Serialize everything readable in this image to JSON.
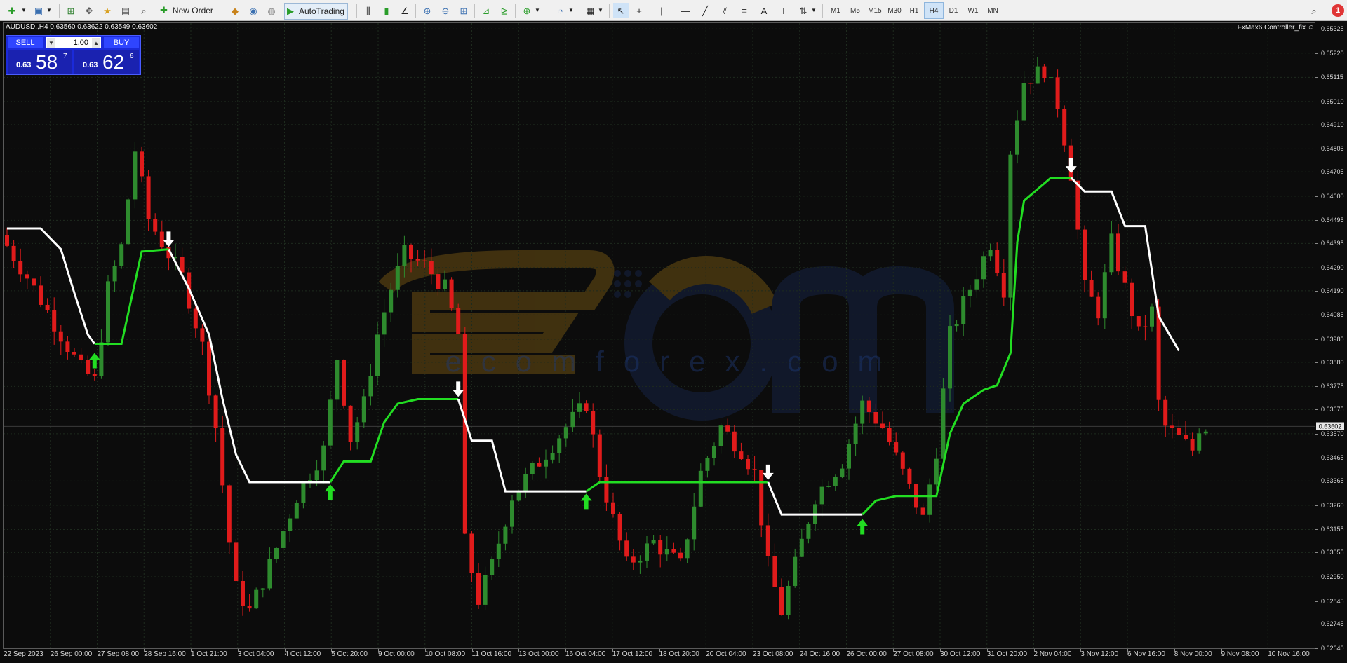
{
  "toolbar": {
    "new_order_label": "New Order",
    "autotrading_label": "AutoTrading",
    "timeframes": [
      "M1",
      "M5",
      "M15",
      "M30",
      "H1",
      "H4",
      "D1",
      "W1",
      "MN"
    ],
    "active_timeframe": "H4",
    "alert_badge": "1"
  },
  "chart": {
    "info": "AUDUSD.,H4  0.63560 0.63622 0.63549 0.63602",
    "indicator_label": "FxMax6 Controller_fix",
    "symbol": "AUDUSD.",
    "timeframe": "H4",
    "open": 0.6356,
    "high": 0.63622,
    "low": 0.63549,
    "close": 0.63602,
    "current_price_label": "0.63602",
    "current_price": 0.63602,
    "colors": {
      "bull": "#2e8b2e",
      "bear": "#e01b1b",
      "trend_up": "#22dd22",
      "trend_down": "#ffffff",
      "background": "#0c0c0c",
      "grid": "#1e2b1e"
    },
    "watermark_text": "ecomforex.com",
    "watermark_logo_letters": "ECOM"
  },
  "trade_panel": {
    "sell_label": "SELL",
    "buy_label": "BUY",
    "lot": "1.00",
    "bid": {
      "prefix": "0.63",
      "big": "58",
      "sup": "7"
    },
    "ask": {
      "prefix": "0.63",
      "big": "62",
      "sup": "6"
    }
  },
  "price_axis": {
    "labels": [
      "0.65325",
      "0.65220",
      "0.65115",
      "0.65010",
      "0.64910",
      "0.64805",
      "0.64705",
      "0.64600",
      "0.64495",
      "0.64395",
      "0.64290",
      "0.64190",
      "0.64085",
      "0.63980",
      "0.63880",
      "0.63775",
      "0.63675",
      "0.63570",
      "0.63465",
      "0.63365",
      "0.63260",
      "0.63155",
      "0.63055",
      "0.62950",
      "0.62845",
      "0.62745",
      "0.62640"
    ]
  },
  "time_axis": {
    "labels": [
      "22 Sep 2023",
      "26 Sep 00:00",
      "27 Sep 08:00",
      "28 Sep 16:00",
      "1 Oct 21:00",
      "3 Oct 04:00",
      "4 Oct 12:00",
      "5 Oct 20:00",
      "9 Oct 00:00",
      "10 Oct 08:00",
      "11 Oct 16:00",
      "13 Oct 00:00",
      "16 Oct 04:00",
      "17 Oct 12:00",
      "18 Oct 20:00",
      "20 Oct 04:00",
      "23 Oct 08:00",
      "24 Oct 16:00",
      "26 Oct 00:00",
      "27 Oct 08:00",
      "30 Oct 12:00",
      "31 Oct 20:00",
      "2 Nov 04:00",
      "3 Nov 12:00",
      "6 Nov 16:00",
      "8 Nov 00:00",
      "9 Nov 08:00",
      "10 Nov 16:00"
    ]
  },
  "chart_data": {
    "type": "candlestick",
    "symbol": "AUDUSD.",
    "timeframe": "H4",
    "ylim": [
      0.6264,
      0.6535
    ],
    "x_range": [
      "22 Sep 2023",
      "10 Nov 16:00"
    ],
    "grid": true,
    "trend_line": [
      {
        "x": 0,
        "y": 0.6446
      },
      {
        "x": 5,
        "y": 0.6446
      },
      {
        "x": 8,
        "y": 0.6437
      },
      {
        "x": 10,
        "y": 0.6418
      },
      {
        "x": 12,
        "y": 0.64
      },
      {
        "x": 13,
        "y": 0.6396
      },
      {
        "x": 17,
        "y": 0.6396
      },
      {
        "x": 20,
        "y": 0.6436
      },
      {
        "x": 24,
        "y": 0.6437
      },
      {
        "x": 27,
        "y": 0.642
      },
      {
        "x": 30,
        "y": 0.64
      },
      {
        "x": 32,
        "y": 0.6372
      },
      {
        "x": 34,
        "y": 0.6348
      },
      {
        "x": 36,
        "y": 0.6336
      },
      {
        "x": 48,
        "y": 0.6336
      },
      {
        "x": 50,
        "y": 0.6345
      },
      {
        "x": 54,
        "y": 0.6345
      },
      {
        "x": 56,
        "y": 0.6362
      },
      {
        "x": 58,
        "y": 0.637
      },
      {
        "x": 61,
        "y": 0.6372
      },
      {
        "x": 67,
        "y": 0.6372
      },
      {
        "x": 69,
        "y": 0.6354
      },
      {
        "x": 72,
        "y": 0.6354
      },
      {
        "x": 74,
        "y": 0.6332
      },
      {
        "x": 86,
        "y": 0.6332
      },
      {
        "x": 88,
        "y": 0.6336
      },
      {
        "x": 113,
        "y": 0.6336
      },
      {
        "x": 115,
        "y": 0.6322
      },
      {
        "x": 127,
        "y": 0.6322
      },
      {
        "x": 129,
        "y": 0.6328
      },
      {
        "x": 132,
        "y": 0.633
      },
      {
        "x": 138,
        "y": 0.633
      },
      {
        "x": 140,
        "y": 0.6357
      },
      {
        "x": 142,
        "y": 0.637
      },
      {
        "x": 145,
        "y": 0.6376
      },
      {
        "x": 147,
        "y": 0.6378
      },
      {
        "x": 149,
        "y": 0.6392
      },
      {
        "x": 150,
        "y": 0.644
      },
      {
        "x": 151,
        "y": 0.6458
      },
      {
        "x": 155,
        "y": 0.6468
      },
      {
        "x": 158,
        "y": 0.6468
      },
      {
        "x": 160,
        "y": 0.6462
      },
      {
        "x": 164,
        "y": 0.6462
      },
      {
        "x": 166,
        "y": 0.6447
      },
      {
        "x": 169,
        "y": 0.6447
      },
      {
        "x": 171,
        "y": 0.6408
      },
      {
        "x": 174,
        "y": 0.6393
      }
    ],
    "trend_colors": [
      {
        "from": 0,
        "to": 13,
        "color": "#ffffff"
      },
      {
        "from": 13,
        "to": 24,
        "color": "#22dd22"
      },
      {
        "from": 24,
        "to": 48,
        "color": "#ffffff"
      },
      {
        "from": 48,
        "to": 67,
        "color": "#22dd22"
      },
      {
        "from": 67,
        "to": 86,
        "color": "#ffffff"
      },
      {
        "from": 86,
        "to": 113,
        "color": "#22dd22"
      },
      {
        "from": 113,
        "to": 127,
        "color": "#ffffff"
      },
      {
        "from": 127,
        "to": 158,
        "color": "#22dd22"
      },
      {
        "from": 158,
        "to": 174,
        "color": "#ffffff"
      }
    ],
    "signals": [
      {
        "i": 13,
        "dir": "up",
        "price": 0.6389
      },
      {
        "i": 24,
        "dir": "down",
        "price": 0.6441
      },
      {
        "i": 48,
        "dir": "up",
        "price": 0.6332
      },
      {
        "i": 67,
        "dir": "down",
        "price": 0.6376
      },
      {
        "i": 86,
        "dir": "up",
        "price": 0.6328
      },
      {
        "i": 113,
        "dir": "down",
        "price": 0.634
      },
      {
        "i": 127,
        "dir": "up",
        "price": 0.6317
      },
      {
        "i": 158,
        "dir": "down",
        "price": 0.6473
      }
    ],
    "candle_path": [
      [
        0,
        0.6443
      ],
      [
        4,
        0.6425
      ],
      [
        8,
        0.6405
      ],
      [
        12,
        0.6385
      ],
      [
        14,
        0.638
      ],
      [
        16,
        0.642
      ],
      [
        18,
        0.6438
      ],
      [
        20,
        0.648
      ],
      [
        22,
        0.645
      ],
      [
        24,
        0.644
      ],
      [
        27,
        0.6425
      ],
      [
        30,
        0.6395
      ],
      [
        32,
        0.636
      ],
      [
        34,
        0.631
      ],
      [
        35,
        0.629
      ],
      [
        37,
        0.628
      ],
      [
        40,
        0.63
      ],
      [
        44,
        0.633
      ],
      [
        48,
        0.635
      ],
      [
        50,
        0.639
      ],
      [
        52,
        0.6355
      ],
      [
        54,
        0.637
      ],
      [
        56,
        0.64
      ],
      [
        58,
        0.642
      ],
      [
        60,
        0.6435
      ],
      [
        63,
        0.643
      ],
      [
        66,
        0.642
      ],
      [
        68,
        0.64
      ],
      [
        69,
        0.631
      ],
      [
        71,
        0.6285
      ],
      [
        73,
        0.63
      ],
      [
        76,
        0.633
      ],
      [
        80,
        0.6345
      ],
      [
        84,
        0.636
      ],
      [
        87,
        0.637
      ],
      [
        89,
        0.634
      ],
      [
        91,
        0.632
      ],
      [
        93,
        0.63
      ],
      [
        97,
        0.631
      ],
      [
        101,
        0.63
      ],
      [
        104,
        0.634
      ],
      [
        107,
        0.636
      ],
      [
        110,
        0.635
      ],
      [
        112,
        0.634
      ],
      [
        114,
        0.63
      ],
      [
        116,
        0.628
      ],
      [
        118,
        0.63
      ],
      [
        121,
        0.633
      ],
      [
        125,
        0.6345
      ],
      [
        128,
        0.637
      ],
      [
        131,
        0.636
      ],
      [
        134,
        0.634
      ],
      [
        137,
        0.632
      ],
      [
        139,
        0.635
      ],
      [
        141,
        0.64
      ],
      [
        144,
        0.642
      ],
      [
        147,
        0.644
      ],
      [
        149,
        0.642
      ],
      [
        150,
        0.648
      ],
      [
        152,
        0.651
      ],
      [
        155,
        0.6515
      ],
      [
        157,
        0.65
      ],
      [
        159,
        0.647
      ],
      [
        161,
        0.642
      ],
      [
        163,
        0.641
      ],
      [
        165,
        0.644
      ],
      [
        167,
        0.642
      ],
      [
        169,
        0.64
      ],
      [
        171,
        0.641
      ],
      [
        172,
        0.637
      ],
      [
        173,
        0.636
      ],
      [
        175,
        0.6355
      ],
      [
        177,
        0.635
      ],
      [
        178,
        0.636
      ]
    ]
  }
}
